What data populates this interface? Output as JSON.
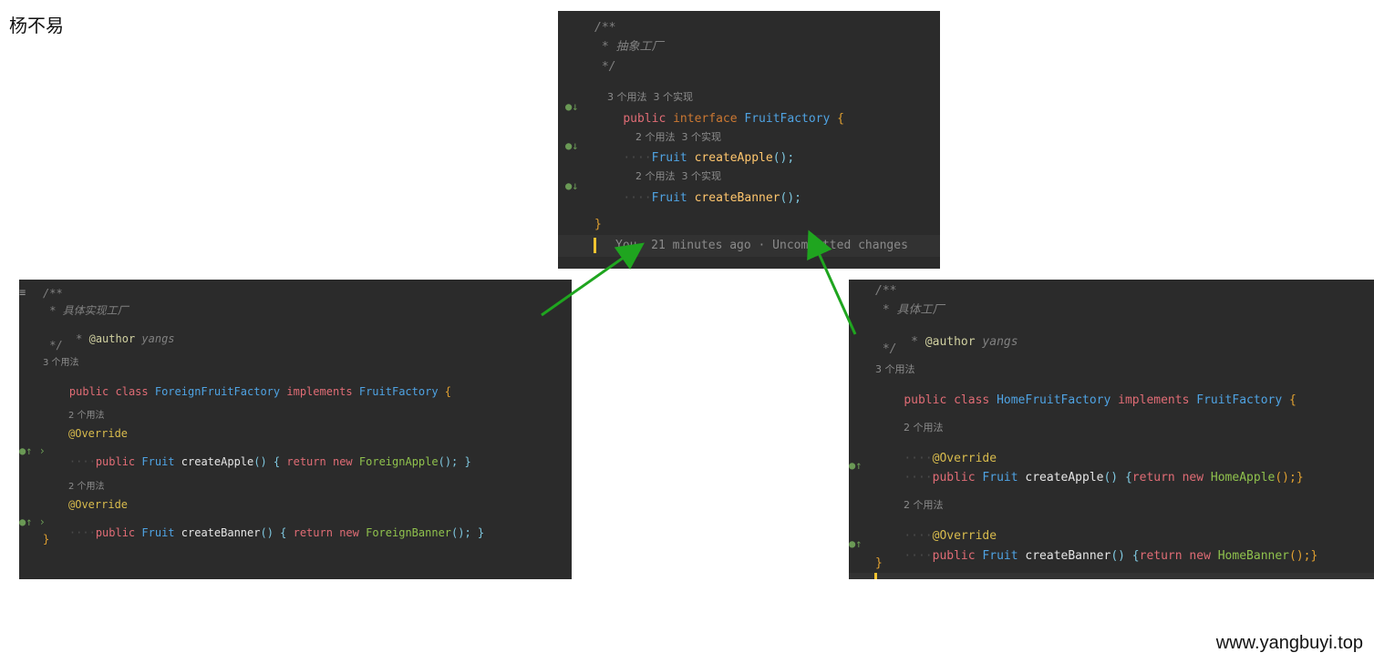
{
  "watermark": {
    "author": "杨不易",
    "site": "www.yangbuyi.top"
  },
  "top": {
    "l1": "/**",
    "l2": " * 抽象工厂",
    "l3": " */",
    "hint_class_uses": "3 个用法",
    "hint_class_impls": "3 个实现",
    "kw_public": "public",
    "kw_interface": "interface",
    "name": "FruitFactory",
    "brace_open": "{",
    "hint_m1_uses": "2 个用法",
    "hint_m1_impls": "3 个实现",
    "m1_type": "Fruit",
    "m1_name": "createApple",
    "m1_tail": "();",
    "hint_m2_uses": "2 个用法",
    "hint_m2_impls": "3 个实现",
    "m2_type": "Fruit",
    "m2_name": "createBanner",
    "m2_tail": "();",
    "brace_close": "}",
    "blame": "You, 21 minutes ago · Uncommitted changes"
  },
  "left": {
    "l1": "/**",
    "l2": " * 具体实现工厂",
    "l3_star": " * ",
    "l3_tag": "@author",
    "l3_val": " yangs",
    "l4": " */",
    "hint_class": "3 个用法",
    "kw_public": "public",
    "kw_class": "class",
    "name": "ForeignFruitFactory",
    "kw_implements": "implements",
    "iface": "FruitFactory",
    "brace_open": "{",
    "hint_m1": "2 个用法",
    "ann1": "@Override",
    "m1_public": "public",
    "m1_type": "Fruit",
    "m1_name": "createApple",
    "m1_open": "() { ",
    "m1_return": "return",
    "m1_new": "new",
    "m1_obj": "ForeignApple",
    "m1_close": "(); }",
    "hint_m2": "2 个用法",
    "ann2": "@Override",
    "m2_public": "public",
    "m2_type": "Fruit",
    "m2_name": "createBanner",
    "m2_open": "() { ",
    "m2_return": "return",
    "m2_new": "new",
    "m2_obj": "ForeignBanner",
    "m2_close": "(); }",
    "brace_close": "}"
  },
  "right": {
    "l1": "/**",
    "l2": " * 具体工厂",
    "l3_star": " * ",
    "l3_tag": "@author",
    "l3_val": " yangs",
    "l4": " */",
    "hint_class": "3 个用法",
    "kw_public": "public",
    "kw_class": "class",
    "name": "HomeFruitFactory",
    "kw_implements": "implements",
    "iface": "FruitFactory",
    "brace_open": "{",
    "hint_m1": "2 个用法",
    "ann1": "@Override",
    "m1_public": "public",
    "m1_type": "Fruit",
    "m1_name": "createApple",
    "m1_open": "() {",
    "m1_return": "return",
    "m1_new": "new",
    "m1_obj": "HomeApple",
    "m1_close": "();}",
    "hint_m2": "2 个用法",
    "ann2": "@Override",
    "m2_public": "public",
    "m2_type": "Fruit",
    "m2_name": "createBanner",
    "m2_open": "() {",
    "m2_return": "return",
    "m2_new": "new",
    "m2_obj": "HomeBanner",
    "m2_close": "();}",
    "brace_close": "}"
  },
  "colors": {
    "arrow": "#1fa51f",
    "editor_bg": "#2b2b2b"
  }
}
